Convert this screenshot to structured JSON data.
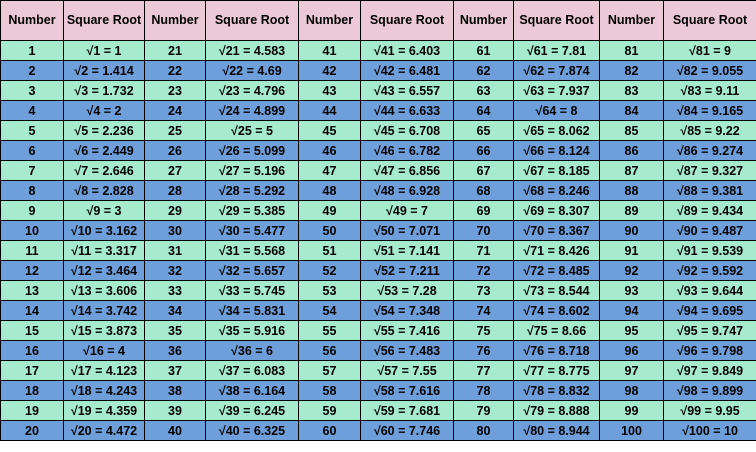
{
  "headers": [
    "Number",
    "Square Root",
    "Number",
    "Square Root",
    "Number",
    "Square Root",
    "Number",
    "Square Root",
    "Number",
    "Square Root"
  ],
  "rows": [
    [
      "1",
      "√1 = 1",
      "21",
      "√21 = 4.583",
      "41",
      "√41 = 6.403",
      "61",
      "√61 = 7.81",
      "81",
      "√81 = 9"
    ],
    [
      "2",
      "√2 = 1.414",
      "22",
      "√22 = 4.69",
      "42",
      "√42 = 6.481",
      "62",
      "√62 = 7.874",
      "82",
      "√82 = 9.055"
    ],
    [
      "3",
      "√3 = 1.732",
      "23",
      "√23 = 4.796",
      "43",
      "√43 = 6.557",
      "63",
      "√63 = 7.937",
      "83",
      "√83 = 9.11"
    ],
    [
      "4",
      "√4 = 2",
      "24",
      "√24 = 4.899",
      "44",
      "√44 = 6.633",
      "64",
      "√64 = 8",
      "84",
      "√84 = 9.165"
    ],
    [
      "5",
      "√5 = 2.236",
      "25",
      "√25 = 5",
      "45",
      "√45 = 6.708",
      "65",
      "√65 = 8.062",
      "85",
      "√85 = 9.22"
    ],
    [
      "6",
      "√6 = 2.449",
      "26",
      "√26 = 5.099",
      "46",
      "√46 = 6.782",
      "66",
      "√66 = 8.124",
      "86",
      "√86 = 9.274"
    ],
    [
      "7",
      "√7 = 2.646",
      "27",
      "√27 = 5.196",
      "47",
      "√47 = 6.856",
      "67",
      "√67 = 8.185",
      "87",
      "√87 = 9.327"
    ],
    [
      "8",
      "√8 = 2.828",
      "28",
      "√28 = 5.292",
      "48",
      "√48 = 6.928",
      "68",
      "√68 = 8.246",
      "88",
      "√88 = 9.381"
    ],
    [
      "9",
      "√9 = 3",
      "29",
      "√29 = 5.385",
      "49",
      "√49 = 7",
      "69",
      "√69 = 8.307",
      "89",
      "√89 = 9.434"
    ],
    [
      "10",
      "√10 = 3.162",
      "30",
      "√30 = 5.477",
      "50",
      "√50 = 7.071",
      "70",
      "√70 = 8.367",
      "90",
      "√90 = 9.487"
    ],
    [
      "11",
      "√11 = 3.317",
      "31",
      "√31 = 5.568",
      "51",
      "√51 = 7.141",
      "71",
      "√71 = 8.426",
      "91",
      "√91 = 9.539"
    ],
    [
      "12",
      "√12 = 3.464",
      "32",
      "√32 = 5.657",
      "52",
      "√52 = 7.211",
      "72",
      "√72 = 8.485",
      "92",
      "√92 = 9.592"
    ],
    [
      "13",
      "√13 = 3.606",
      "33",
      "√33 = 5.745",
      "53",
      "√53 = 7.28",
      "73",
      "√73 = 8.544",
      "93",
      "√93 = 9.644"
    ],
    [
      "14",
      "√14 = 3.742",
      "34",
      "√34 = 5.831",
      "54",
      "√54 = 7.348",
      "74",
      "√74 = 8.602",
      "94",
      "√94 = 9.695"
    ],
    [
      "15",
      "√15 = 3.873",
      "35",
      "√35 = 5.916",
      "55",
      "√55 = 7.416",
      "75",
      "√75 = 8.66",
      "95",
      "√95 = 9.747"
    ],
    [
      "16",
      "√16 = 4",
      "36",
      "√36 = 6",
      "56",
      "√56 = 7.483",
      "76",
      "√76 = 8.718",
      "96",
      "√96 = 9.798"
    ],
    [
      "17",
      "√17 = 4.123",
      "37",
      "√37 = 6.083",
      "57",
      "√57 = 7.55",
      "77",
      "√77 = 8.775",
      "97",
      "√97 = 9.849"
    ],
    [
      "18",
      "√18 = 4.243",
      "38",
      "√38 = 6.164",
      "58",
      "√58 = 7.616",
      "78",
      "√78 = 8.832",
      "98",
      "√98 = 9.899"
    ],
    [
      "19",
      "√19 = 4.359",
      "39",
      "√39 = 6.245",
      "59",
      "√59 = 7.681",
      "79",
      "√79 = 8.888",
      "99",
      "√99 = 9.95"
    ],
    [
      "20",
      "√20 = 4.472",
      "40",
      "√40 = 6.325",
      "60",
      "√60 = 7.746",
      "80",
      "√80 = 8.944",
      "100",
      "√100 = 10"
    ]
  ],
  "colors": {
    "header_bg": "#ecc9d6",
    "row_odd_bg": "#a6ebcd",
    "row_even_bg": "#6e9fda",
    "border": "#000000"
  }
}
